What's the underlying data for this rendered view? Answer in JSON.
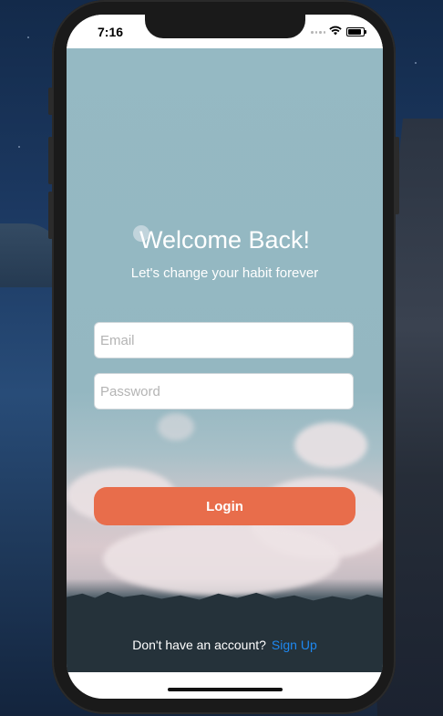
{
  "status_bar": {
    "time": "7:16"
  },
  "login": {
    "title": "Welcome Back!",
    "subtitle": "Let's change your habit forever",
    "email_placeholder": "Email",
    "email_value": "",
    "password_placeholder": "Password",
    "password_value": "",
    "login_label": "Login"
  },
  "footer": {
    "prompt": "Don't have an account?",
    "signup_label": "Sign Up"
  },
  "colors": {
    "accent": "#e86d4b",
    "link": "#1e88f0",
    "sky": "#95b9c3"
  },
  "icons": [
    "signal-icon",
    "wifi-icon",
    "battery-icon"
  ]
}
